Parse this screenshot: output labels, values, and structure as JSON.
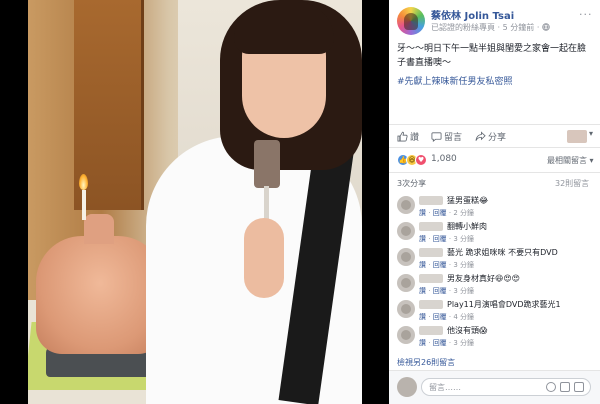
{
  "post": {
    "page_name": "蔡依林 Jolin Tsai",
    "verified_label": "已認證的粉絲專頁",
    "time": "5 分鐘前",
    "audience_icon": "globe-icon",
    "text": "牙～～明日下午一點半姐與閨愛之家會一起在臉子書直播噢～",
    "hashtag": "#先獻上辣味新任男友私密照"
  },
  "actions": {
    "like": "讚",
    "comment": "留言",
    "share": "分享"
  },
  "reactions": {
    "count": "1,080",
    "types": [
      "like-reaction-icon",
      "haha-reaction-icon",
      "love-reaction-icon"
    ],
    "sort_label": "最相關留言"
  },
  "stats": {
    "shares": "3次分享",
    "comments": "32則留言"
  },
  "comments": [
    {
      "text": "猛男蛋糕😂",
      "like": "讚",
      "reply": "回覆",
      "time": "2 分鐘"
    },
    {
      "text": "翻轉小鮮肉",
      "like": "讚",
      "reply": "回覆",
      "time": "3 分鐘"
    },
    {
      "text": "藝光 跪求姐咪咪 不要只有DVD",
      "like": "讚",
      "reply": "回覆",
      "time": "3 分鐘"
    },
    {
      "text": "男友身材真好😆😍😍",
      "like": "讚",
      "reply": "回覆",
      "time": "3 分鐘"
    },
    {
      "text": "Play11月演唱會DVD跪求藝光1",
      "like": "讚",
      "reply": "回覆",
      "time": "4 分鐘"
    },
    {
      "text": "他沒有頭😱",
      "like": "讚",
      "reply": "回覆",
      "time": "3 分鐘"
    }
  ],
  "view_more": "檢視另26則留言",
  "composer": {
    "placeholder": "留言……"
  },
  "colors": {
    "link_blue": "#365899",
    "meta_gray": "#90949c",
    "like_blue": "#4a90e2",
    "love_red": "#f0506e",
    "haha_yellow": "#f7c843"
  }
}
